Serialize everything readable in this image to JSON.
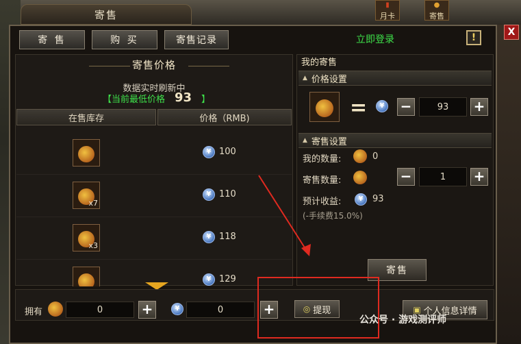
{
  "window": {
    "title": "寄售"
  },
  "top_icons": [
    {
      "label": "月卡",
      "icon": "card-icon"
    },
    {
      "label": "寄售",
      "icon": "bag-icon"
    }
  ],
  "tabs": [
    {
      "label": "寄 售"
    },
    {
      "label": "购 买"
    },
    {
      "label": "寄售记录"
    }
  ],
  "header": {
    "login": "立即登录",
    "help": "!",
    "close": "X"
  },
  "market": {
    "heading": "寄售价格",
    "refresh_note": "数据实时刷新中",
    "lowest_label": "【当前最低价格",
    "lowest_value": "93",
    "lowest_close": "】",
    "columns": [
      "在售库存",
      "价格（RMB)"
    ],
    "rows": [
      {
        "qty": "",
        "price": "100"
      },
      {
        "qty": "x7",
        "price": "110"
      },
      {
        "qty": "x3",
        "price": "118"
      },
      {
        "qty": "",
        "price": "129"
      }
    ]
  },
  "my_consign": {
    "title": "我的寄售",
    "price_section": "价格设置",
    "equals": "=",
    "price_value": "93",
    "sale_section": "寄售设置",
    "my_qty_label": "我的数量:",
    "my_qty_value": "0",
    "sell_qty_label": "寄售数量:",
    "sell_qty_value": "1",
    "income_label": "预计收益:",
    "income_value": "93",
    "fee_note": "(-手续费15.0%)",
    "submit": "寄售",
    "minus": "−",
    "plus": "+"
  },
  "bottom": {
    "own_label": "拥有",
    "item_count": "0",
    "coin_count": "0",
    "withdraw": "提现",
    "profile": "个人信息详情"
  },
  "coin_glyph": "¥",
  "watermark": "公众号 · 游戏测评师",
  "colors": {
    "accent_green": "#3ee04a",
    "annotation_red": "#e02a20",
    "arrow_orange": "#e6a620"
  }
}
